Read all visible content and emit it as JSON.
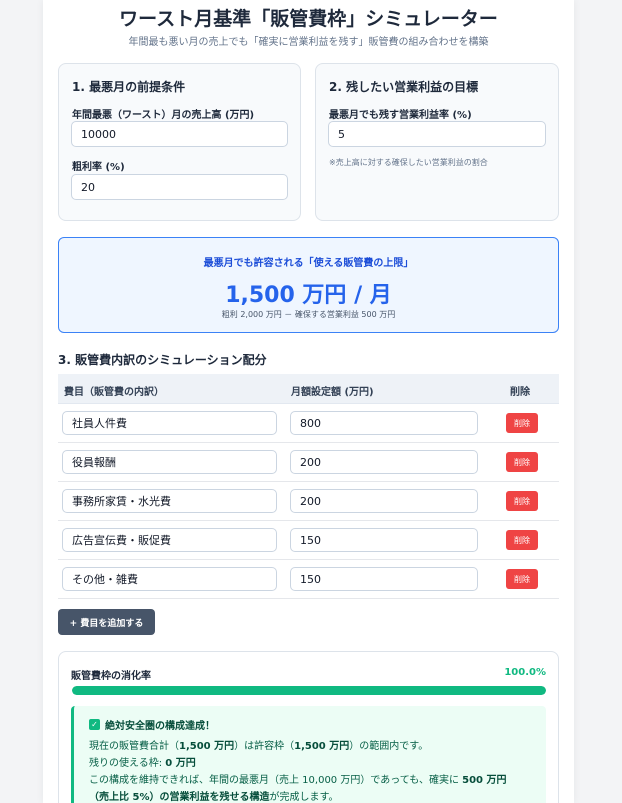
{
  "header": {
    "title": "ワースト月基準「販管費枠」シミュレーター",
    "subtitle": "年間最も悪い月の売上でも「確実に営業利益を残す」販管費の組み合わせを構築"
  },
  "conditions": {
    "title": "1. 最悪月の前提条件",
    "sales_label": "年間最悪（ワースト）月の売上高 (万円)",
    "sales_value": "10000",
    "margin_label": "粗利率 (%)",
    "margin_value": "20"
  },
  "target": {
    "title": "2. 残したい営業利益の目標",
    "rate_label": "最悪月でも残す営業利益率 (%)",
    "rate_value": "5",
    "hint": "※売上高に対する確保したい営業利益の割合"
  },
  "limit": {
    "label": "最悪月でも許容される「使える販管費の上限」",
    "value": "1,500 万円 / 月",
    "detail": "粗利 2,000 万円 － 確保する営業利益 500 万円"
  },
  "breakdown": {
    "title": "3. 販管費内訳のシミュレーション配分",
    "col_item": "費目（販管費の内訳）",
    "col_amount": "月額設定額 (万円)",
    "col_delete": "削除",
    "delete_label": "削除",
    "rows": [
      {
        "name": "社員人件費",
        "amount": "800"
      },
      {
        "name": "役員報酬",
        "amount": "200"
      },
      {
        "name": "事務所家賃・水光費",
        "amount": "200"
      },
      {
        "name": "広告宣伝費・販促費",
        "amount": "150"
      },
      {
        "name": "その他・雑費",
        "amount": "150"
      }
    ],
    "add_label": "+ 費目を追加する"
  },
  "usage": {
    "label": "販管費枠の消化率",
    "percent_text": "100.0%",
    "percent_value": 100,
    "status_title": "絶対安全圏の構成達成！",
    "line1_pre": "現在の販管費合計（",
    "line1_total": "1,500 万円",
    "line1_mid": "）は許容枠（",
    "line1_limit": "1,500 万円",
    "line1_post": "）の範囲内です。",
    "line2_pre": "残りの使える枠: ",
    "line2_value": "0 万円",
    "line3_pre": "この構成を維持できれば、年間の最悪月（売上 10,000 万円）であっても、確実に ",
    "line3_bold": "500 万円",
    "line4_bold": "（売上比 5%）の営業利益を残せる構造",
    "line4_post": "が完成します。"
  },
  "colors": {
    "accent_blue": "#2563eb",
    "success_green": "#10b981",
    "danger_red": "#ef4444"
  }
}
